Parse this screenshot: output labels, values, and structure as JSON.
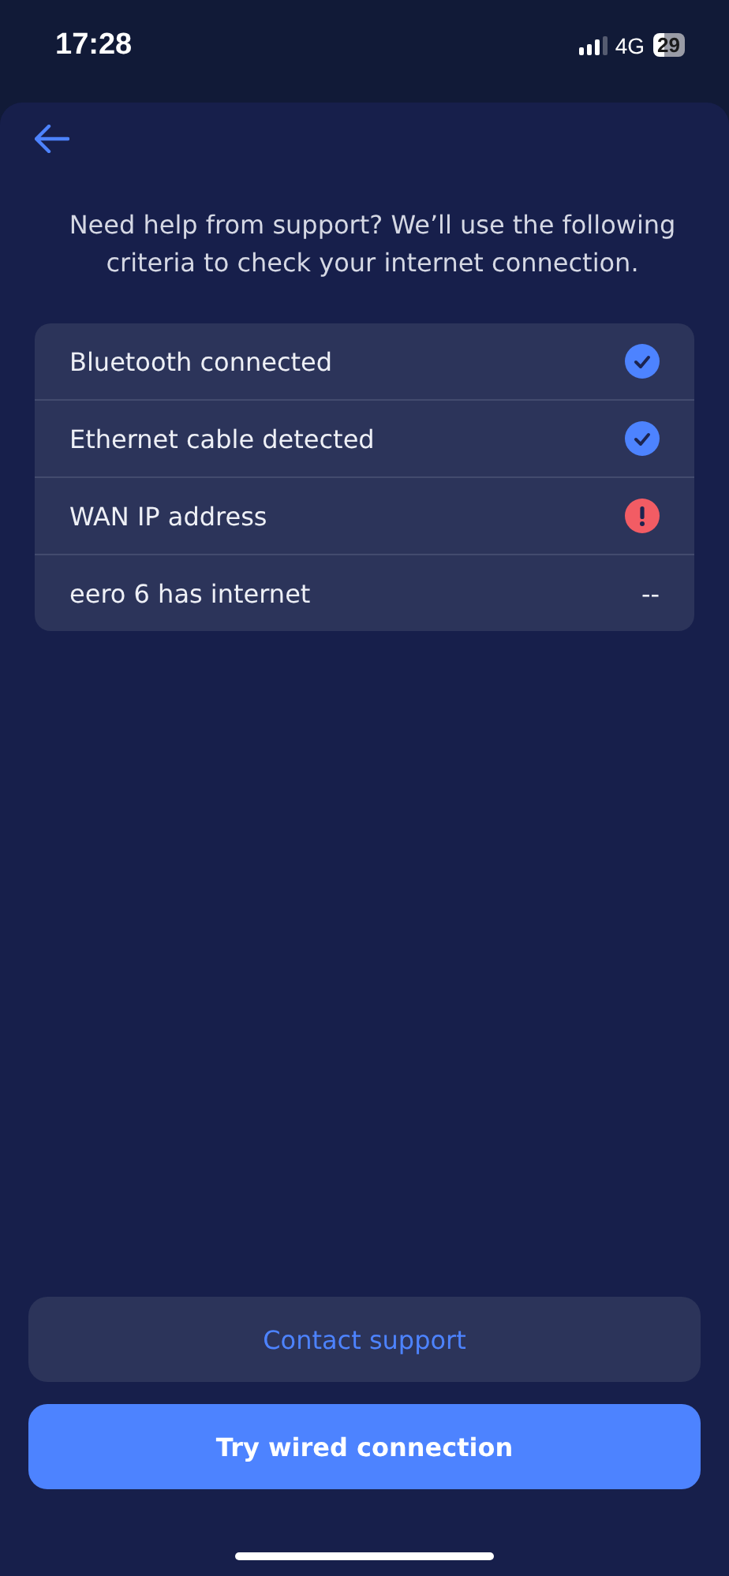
{
  "status_bar": {
    "time": "17:28",
    "network": "4G",
    "battery": "29"
  },
  "intro": "Need help from support? We’ll use the following criteria to check your internet connection.",
  "checks": [
    {
      "label": "Bluetooth connected",
      "kind": "ok"
    },
    {
      "label": "Ethernet cable detected",
      "kind": "ok"
    },
    {
      "label": "WAN IP address",
      "kind": "error"
    },
    {
      "label": "eero 6 has internet",
      "kind": "unknown",
      "value": "--"
    }
  ],
  "buttons": [
    {
      "label": "Contact support",
      "kind": "secondary"
    },
    {
      "label": "Try wired connection",
      "kind": "primary"
    }
  ]
}
